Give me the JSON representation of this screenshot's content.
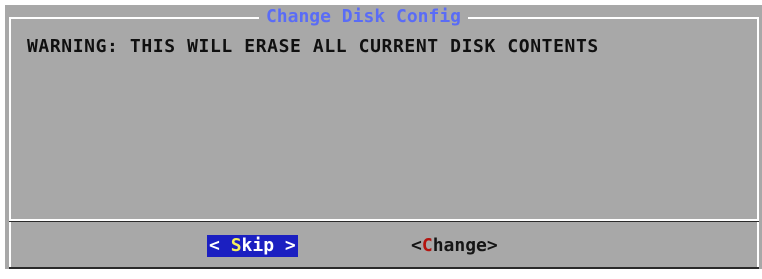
{
  "dialog": {
    "title": "Change Disk Config",
    "message": "WARNING: THIS WILL ERASE ALL CURRENT DISK CONTENTS"
  },
  "buttons": {
    "skip": {
      "open": "< ",
      "hotkey": "S",
      "rest": "kip",
      "close": " >",
      "selected": true
    },
    "change": {
      "open": "<",
      "hotkey": "C",
      "rest": "hange",
      "close": ">",
      "selected": false
    }
  },
  "colors": {
    "dialog_background": "#a8a8a8",
    "title_text": "#5a6cf6",
    "selected_button_background": "#1b1fc1",
    "selected_hotkey": "#f5f05c",
    "unselected_hotkey": "#b4140f"
  }
}
